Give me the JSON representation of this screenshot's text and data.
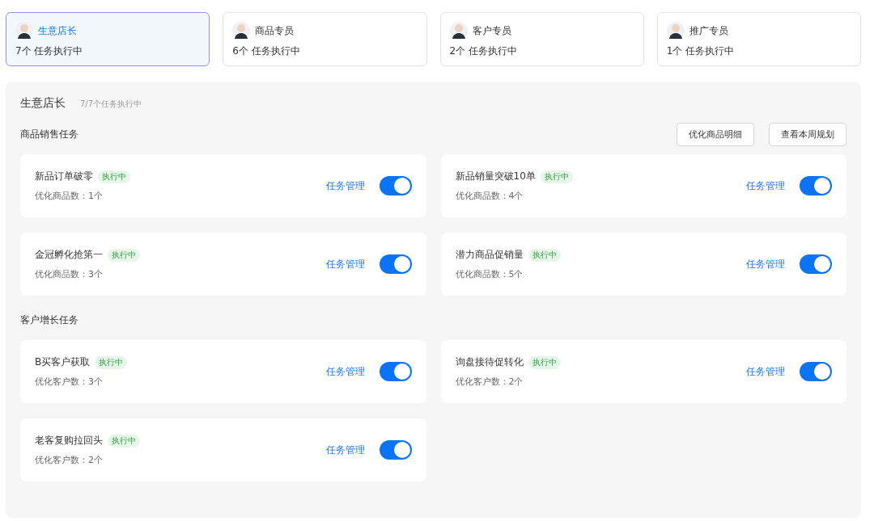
{
  "roles": [
    {
      "name": "生意店长",
      "count": "7个 任务执行中",
      "selected": true
    },
    {
      "name": "商品专员",
      "count": "6个 任务执行中",
      "selected": false
    },
    {
      "name": "客户专员",
      "count": "2个 任务执行中",
      "selected": false
    },
    {
      "name": "推广专员",
      "count": "1个 任务执行中",
      "selected": false
    }
  ],
  "panel": {
    "title": "生意店长",
    "subtitle": "7/7个任务执行中",
    "sections": [
      {
        "title": "商品销售任务",
        "buttons": [
          "优化商品明细",
          "查看本周规划"
        ],
        "tasks": [
          {
            "name": "新品订单破零",
            "status": "执行中",
            "detail": "优化商品数：1个",
            "link": "任务管理",
            "on": true
          },
          {
            "name": "新品销量突破10单",
            "status": "执行中",
            "detail": "优化商品数：4个",
            "link": "任务管理",
            "on": true
          },
          {
            "name": "金冠孵化抢第一",
            "status": "执行中",
            "detail": "优化商品数：3个",
            "link": "任务管理",
            "on": true
          },
          {
            "name": "潜力商品促销量",
            "status": "执行中",
            "detail": "优化商品数：5个",
            "link": "任务管理",
            "on": true
          }
        ]
      },
      {
        "title": "客户增长任务",
        "tasks": [
          {
            "name": "B买客户获取",
            "status": "执行中",
            "detail": "优化客户数：3个",
            "link": "任务管理",
            "on": true
          },
          {
            "name": "询盘接待促转化",
            "status": "执行中",
            "detail": "优化客户数：2个",
            "link": "任务管理",
            "on": true
          },
          {
            "name": "老客复购拉回头",
            "status": "执行中",
            "detail": "优化客户数：2个",
            "link": "任务管理",
            "on": true
          }
        ]
      }
    ]
  }
}
